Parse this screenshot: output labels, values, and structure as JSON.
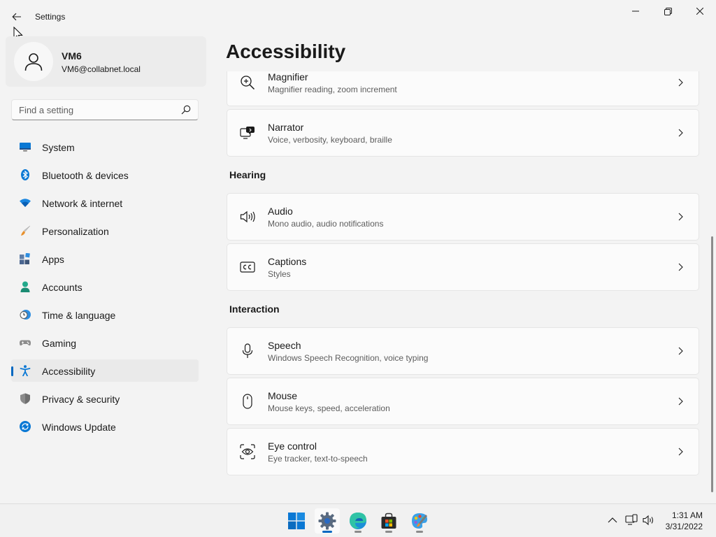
{
  "window": {
    "title": "Settings"
  },
  "profile": {
    "name": "VM6",
    "email": "VM6@collabnet.local"
  },
  "search": {
    "placeholder": "Find a setting"
  },
  "nav": {
    "items": [
      {
        "label": "System",
        "icon": "monitor-icon"
      },
      {
        "label": "Bluetooth & devices",
        "icon": "bluetooth-icon"
      },
      {
        "label": "Network & internet",
        "icon": "wifi-icon"
      },
      {
        "label": "Personalization",
        "icon": "paintbrush-icon"
      },
      {
        "label": "Apps",
        "icon": "apps-icon"
      },
      {
        "label": "Accounts",
        "icon": "person-icon"
      },
      {
        "label": "Time & language",
        "icon": "clock-globe-icon"
      },
      {
        "label": "Gaming",
        "icon": "gamepad-icon"
      },
      {
        "label": "Accessibility",
        "icon": "accessibility-icon",
        "active": true
      },
      {
        "label": "Privacy & security",
        "icon": "shield-icon"
      },
      {
        "label": "Windows Update",
        "icon": "update-icon"
      }
    ]
  },
  "page": {
    "title": "Accessibility"
  },
  "sections": {
    "hearing": "Hearing",
    "interaction": "Interaction"
  },
  "cards": {
    "magnifier": {
      "title": "Magnifier",
      "subtitle": "Magnifier reading, zoom increment",
      "icon": "magnifier-icon"
    },
    "narrator": {
      "title": "Narrator",
      "subtitle": "Voice, verbosity, keyboard, braille",
      "icon": "narrator-icon"
    },
    "audio": {
      "title": "Audio",
      "subtitle": "Mono audio, audio notifications",
      "icon": "speaker-icon"
    },
    "captions": {
      "title": "Captions",
      "subtitle": "Styles",
      "icon": "cc-icon"
    },
    "speech": {
      "title": "Speech",
      "subtitle": "Windows Speech Recognition, voice typing",
      "icon": "microphone-icon"
    },
    "mouse": {
      "title": "Mouse",
      "subtitle": "Mouse keys, speed, acceleration",
      "icon": "mouse-icon"
    },
    "eye_control": {
      "title": "Eye control",
      "subtitle": "Eye tracker, text-to-speech",
      "icon": "eye-control-icon"
    }
  },
  "taskbar": {
    "apps": [
      "windows-start-icon",
      "settings-gear-icon",
      "edge-browser-icon",
      "store-icon",
      "paint-icon"
    ],
    "clock": {
      "time": "1:31 AM",
      "date": "3/31/2022"
    }
  },
  "colors": {
    "accent": "#0067c0",
    "background": "#f3f3f3",
    "card": "#fbfbfb"
  }
}
